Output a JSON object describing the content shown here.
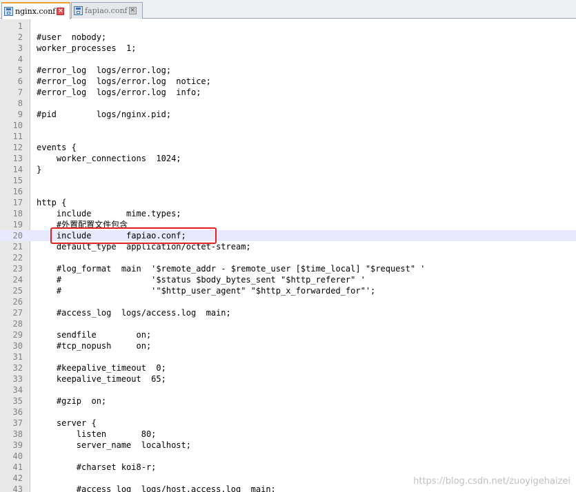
{
  "tabs": [
    {
      "label": "nginx.conf",
      "active": true
    },
    {
      "label": "fapiao.conf",
      "active": false
    }
  ],
  "editor": {
    "current_line": 20,
    "highlighted_line": 20,
    "lines": [
      {
        "n": "1",
        "text": ""
      },
      {
        "n": "2",
        "text": "#user  nobody;"
      },
      {
        "n": "3",
        "text": "worker_processes  1;"
      },
      {
        "n": "4",
        "text": ""
      },
      {
        "n": "5",
        "text": "#error_log  logs/error.log;"
      },
      {
        "n": "6",
        "text": "#error_log  logs/error.log  notice;"
      },
      {
        "n": "7",
        "text": "#error_log  logs/error.log  info;"
      },
      {
        "n": "8",
        "text": ""
      },
      {
        "n": "9",
        "text": "#pid        logs/nginx.pid;"
      },
      {
        "n": "10",
        "text": ""
      },
      {
        "n": "11",
        "text": ""
      },
      {
        "n": "12",
        "text": "events {"
      },
      {
        "n": "13",
        "text": "    worker_connections  1024;"
      },
      {
        "n": "14",
        "text": "}"
      },
      {
        "n": "15",
        "text": ""
      },
      {
        "n": "16",
        "text": ""
      },
      {
        "n": "17",
        "text": "http {"
      },
      {
        "n": "18",
        "text": "    include       mime.types;"
      },
      {
        "n": "19",
        "text": "    #外置配置文件包含"
      },
      {
        "n": "20",
        "text": "    include       fapiao.conf;"
      },
      {
        "n": "21",
        "text": "    default_type  application/octet-stream;"
      },
      {
        "n": "22",
        "text": ""
      },
      {
        "n": "23",
        "text": "    #log_format  main  '$remote_addr - $remote_user [$time_local] \"$request\" '"
      },
      {
        "n": "24",
        "text": "    #                  '$status $body_bytes_sent \"$http_referer\" '"
      },
      {
        "n": "25",
        "text": "    #                  '\"$http_user_agent\" \"$http_x_forwarded_for\"';"
      },
      {
        "n": "26",
        "text": ""
      },
      {
        "n": "27",
        "text": "    #access_log  logs/access.log  main;"
      },
      {
        "n": "28",
        "text": ""
      },
      {
        "n": "29",
        "text": "    sendfile        on;"
      },
      {
        "n": "30",
        "text": "    #tcp_nopush     on;"
      },
      {
        "n": "31",
        "text": ""
      },
      {
        "n": "32",
        "text": "    #keepalive_timeout  0;"
      },
      {
        "n": "33",
        "text": "    keepalive_timeout  65;"
      },
      {
        "n": "34",
        "text": ""
      },
      {
        "n": "35",
        "text": "    #gzip  on;"
      },
      {
        "n": "36",
        "text": ""
      },
      {
        "n": "37",
        "text": "    server {"
      },
      {
        "n": "38",
        "text": "        listen       80;"
      },
      {
        "n": "39",
        "text": "        server_name  localhost;"
      },
      {
        "n": "40",
        "text": ""
      },
      {
        "n": "41",
        "text": "        #charset koi8-r;"
      },
      {
        "n": "42",
        "text": ""
      },
      {
        "n": "43",
        "text": "        #access_log  logs/host.access.log  main;"
      }
    ]
  },
  "watermark": "https://blog.csdn.net/zuoyigehaizei",
  "colors": {
    "highlight_box": "#e02020",
    "current_line": "#e8e8ff",
    "gutter": "#e8e8e8"
  }
}
